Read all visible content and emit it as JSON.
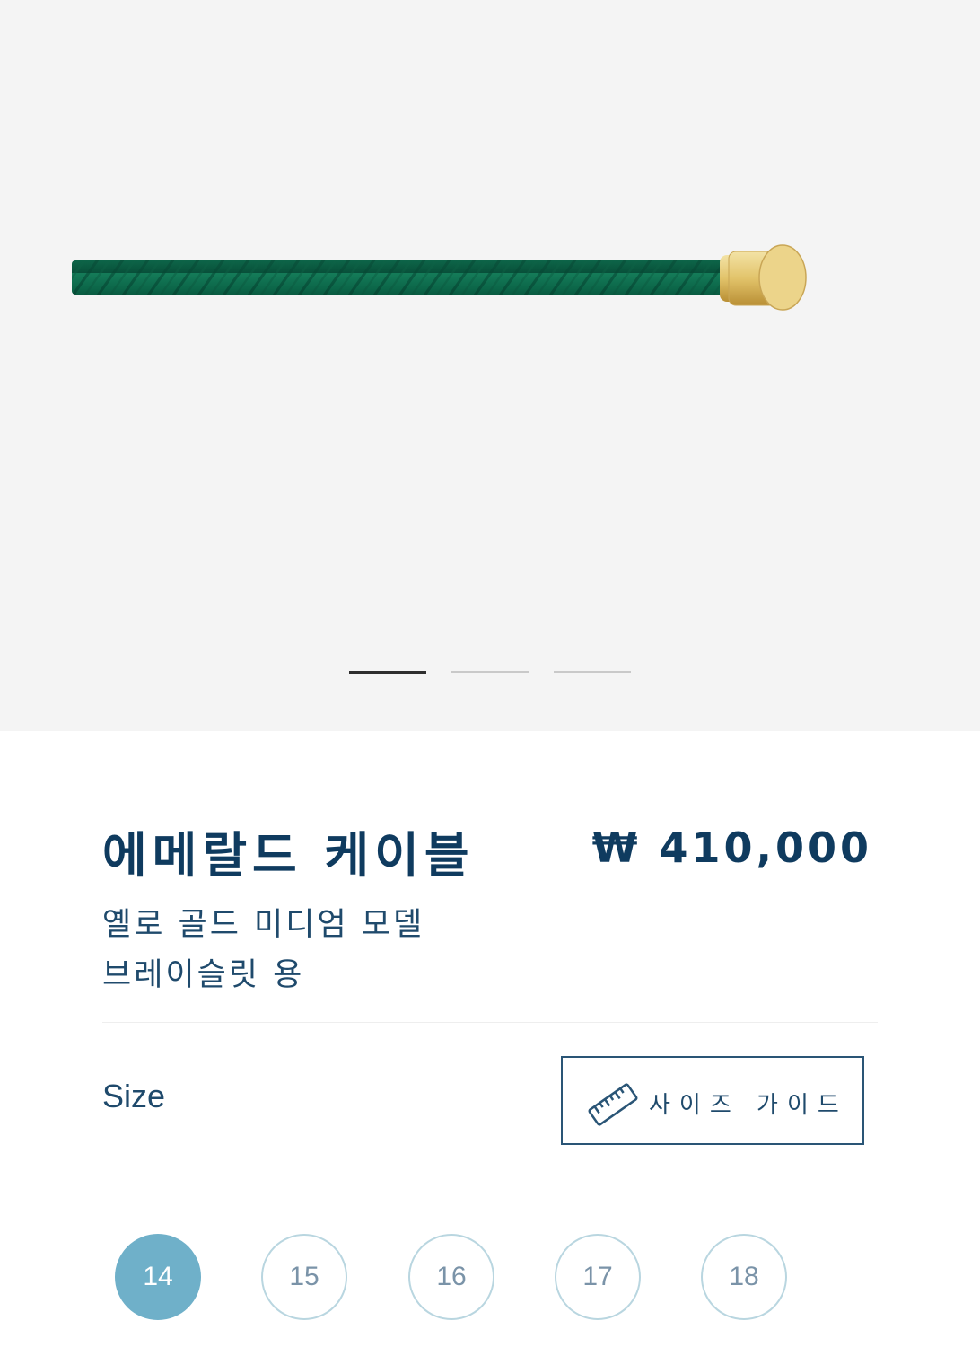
{
  "product": {
    "title": "에메랄드 케이블",
    "price": "₩ 410,000",
    "subtitle_lines": [
      "옐로 골드 미디엄 모델",
      "브레이슬릿 용"
    ]
  },
  "gallery": {
    "slide_count": 3,
    "active_slide": 1
  },
  "size_section": {
    "label": "Size",
    "guide_button": "사이즈 가이드",
    "guide_icon": "ruler-icon",
    "options": [
      "14",
      "15",
      "16",
      "17",
      "18"
    ],
    "selected": "14"
  },
  "colors": {
    "brand_navy": "#0f3b5f",
    "cable_green": "#0c6b4c",
    "gold": "#e2c36a",
    "selected_size": "#6fb0c9",
    "size_border": "#b9d6e0"
  }
}
